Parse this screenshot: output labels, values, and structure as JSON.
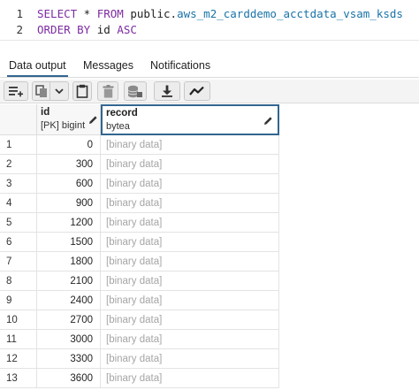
{
  "editor": {
    "lines": [
      {
        "num": "1",
        "kw1": "SELECT",
        "mid": " * ",
        "kw2": "FROM",
        "ident": " public",
        "dot": ".",
        "table": "aws_m2_carddemo_acctdata_vsam_ksds"
      },
      {
        "num": "2",
        "kw1": "ORDER BY",
        "rest": " id ",
        "kw2": "ASC"
      }
    ]
  },
  "tabs": [
    {
      "label": "Data output",
      "active": true
    },
    {
      "label": "Messages",
      "active": false
    },
    {
      "label": "Notifications",
      "active": false
    }
  ],
  "toolbar": {
    "buttons": [
      {
        "icon": "add-row-icon"
      },
      {
        "icon": "copy-icon"
      },
      {
        "icon": "chevron-down-icon"
      },
      {
        "icon": "paste-icon"
      },
      {
        "icon": "delete-icon"
      },
      {
        "icon": "save-data-icon"
      },
      {
        "icon": "download-icon"
      },
      {
        "icon": "graph-visualiser-icon"
      }
    ]
  },
  "grid": {
    "columns": [
      {
        "name": "id",
        "type": "[PK] bigint"
      },
      {
        "name": "record",
        "type": "bytea"
      }
    ],
    "rows": [
      {
        "n": "1",
        "id": "0",
        "record": "[binary data]"
      },
      {
        "n": "2",
        "id": "300",
        "record": "[binary data]"
      },
      {
        "n": "3",
        "id": "600",
        "record": "[binary data]"
      },
      {
        "n": "4",
        "id": "900",
        "record": "[binary data]"
      },
      {
        "n": "5",
        "id": "1200",
        "record": "[binary data]"
      },
      {
        "n": "6",
        "id": "1500",
        "record": "[binary data]"
      },
      {
        "n": "7",
        "id": "1800",
        "record": "[binary data]"
      },
      {
        "n": "8",
        "id": "2100",
        "record": "[binary data]"
      },
      {
        "n": "9",
        "id": "2400",
        "record": "[binary data]"
      },
      {
        "n": "10",
        "id": "2700",
        "record": "[binary data]"
      },
      {
        "n": "11",
        "id": "3000",
        "record": "[binary data]"
      },
      {
        "n": "12",
        "id": "3300",
        "record": "[binary data]"
      },
      {
        "n": "13",
        "id": "3600",
        "record": "[binary data]"
      }
    ]
  }
}
